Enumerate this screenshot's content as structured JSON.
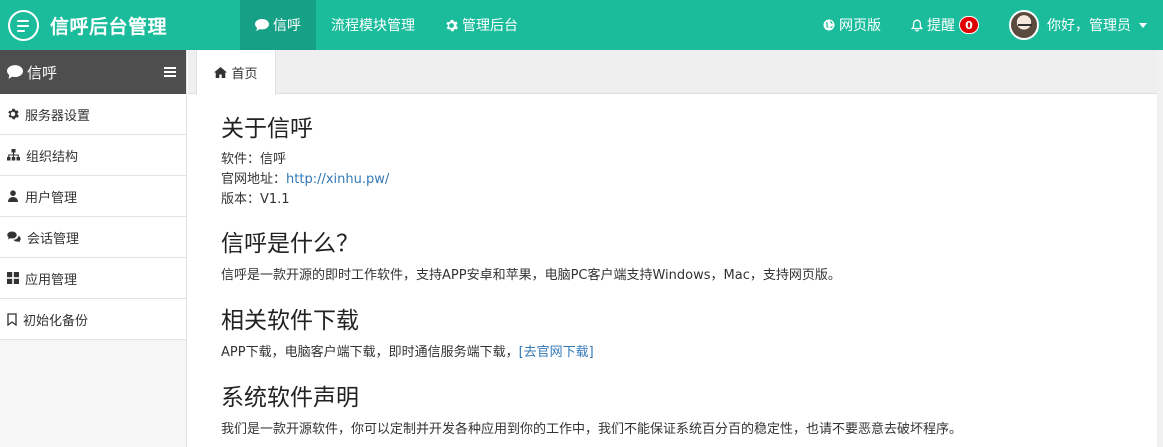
{
  "header": {
    "brand_title": "信呼后台管理",
    "nav": [
      {
        "label": "信呼",
        "icon": "comment-icon"
      },
      {
        "label": "流程模块管理",
        "icon": ""
      },
      {
        "label": "管理后台",
        "icon": "gear-icon"
      }
    ],
    "web_version": "网页版",
    "reminder": "提醒",
    "reminder_count": "0",
    "user_greeting": "你好，管理员"
  },
  "sidebar": {
    "title": "信呼",
    "items": [
      {
        "label": "服务器设置",
        "icon": "gear-icon"
      },
      {
        "label": "组织结构",
        "icon": "sitemap-icon"
      },
      {
        "label": "用户管理",
        "icon": "user-icon"
      },
      {
        "label": "会话管理",
        "icon": "comments-icon"
      },
      {
        "label": "应用管理",
        "icon": "grid-icon"
      },
      {
        "label": "初始化备份",
        "icon": "bookmark-icon"
      }
    ]
  },
  "tabs": [
    {
      "label": "首页",
      "icon": "home-icon"
    }
  ],
  "content": {
    "about_title": "关于信呼",
    "software_line": "软件：信呼",
    "site_prefix": "官网地址：",
    "site_url": "http://xinhu.pw/",
    "version_line": "版本：V1.1",
    "what_title": "信呼是什么？",
    "what_text": "信呼是一款开源的即时工作软件，支持APP安卓和苹果，电脑PC客户端支持Windows，Mac，支持网页版。",
    "download_title": "相关软件下载",
    "download_text": "APP下载，电脑客户端下载，即时通信服务端下载，",
    "download_link": "[去官网下载]",
    "statement_title": "系统软件声明",
    "statement_text": "我们是一款开源软件，你可以定制并开发各种应用到你的工作中，我们不能保证系统百分百的稳定性，也请不要恶意去破坏程序。"
  },
  "colors": {
    "topbar": "#1abc9c",
    "active_nav": "#16a085",
    "sidebar_head": "#4e4e4e",
    "link": "#337ab7",
    "badge": "#e00000"
  }
}
